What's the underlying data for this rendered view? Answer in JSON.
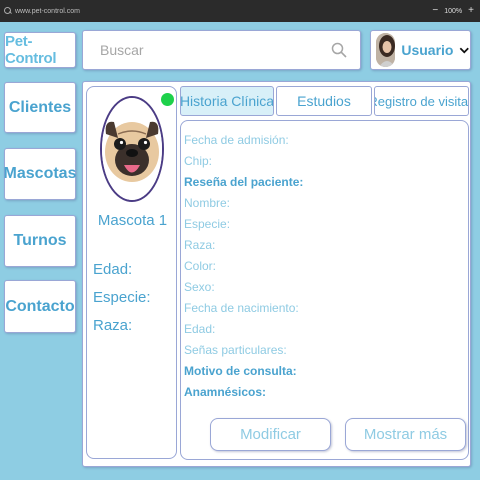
{
  "browser": {
    "url": "www.pet-control.com",
    "zoom": "100%",
    "minimize_glyph": "−",
    "zoom_in_glyph": "+"
  },
  "header": {
    "brand": "Pet-Control",
    "search_placeholder": "Buscar",
    "user_name": "Usuario"
  },
  "sidebar": {
    "items": [
      {
        "label": "Clientes"
      },
      {
        "label": "Mascotas"
      },
      {
        "label": "Turnos"
      },
      {
        "label": "Contacto"
      }
    ]
  },
  "pet": {
    "name": "Mascota 1",
    "fields": [
      {
        "label": "Edad:"
      },
      {
        "label": "Especie:"
      },
      {
        "label": "Raza:"
      }
    ],
    "status_color": "#1ed14b"
  },
  "tabs": [
    {
      "label": "Historia Clínica",
      "active": true
    },
    {
      "label": "Estudios",
      "active": false
    },
    {
      "label": "Registro de visitas",
      "active": false
    }
  ],
  "record": {
    "rows": [
      {
        "label": "Fecha de admisión:",
        "bold": false
      },
      {
        "label": "Chip:",
        "bold": false
      },
      {
        "label": "Reseña del paciente:",
        "bold": true
      },
      {
        "label": "Nombre:",
        "bold": false
      },
      {
        "label": "Especie:",
        "bold": false
      },
      {
        "label": "Raza:",
        "bold": false
      },
      {
        "label": "Color:",
        "bold": false
      },
      {
        "label": "Sexo:",
        "bold": false
      },
      {
        "label": "Fecha de nacimiento:",
        "bold": false
      },
      {
        "label": "Edad:",
        "bold": false
      },
      {
        "label": "Señas particulares:",
        "bold": false
      },
      {
        "label": "Motivo de consulta:",
        "bold": true
      },
      {
        "label": "Anamnésicos:",
        "bold": true
      }
    ],
    "actions": {
      "modify": "Modificar",
      "show_more": "Mostrar más"
    }
  },
  "icons": {
    "search": "search-icon",
    "chevron": "chevron-down-icon",
    "avatar": "avatar"
  },
  "colors": {
    "background": "#8ecde3",
    "accent": "#4aa3cf",
    "muted_text": "#8fcbe3",
    "active_tab": "#d8f0f8"
  }
}
